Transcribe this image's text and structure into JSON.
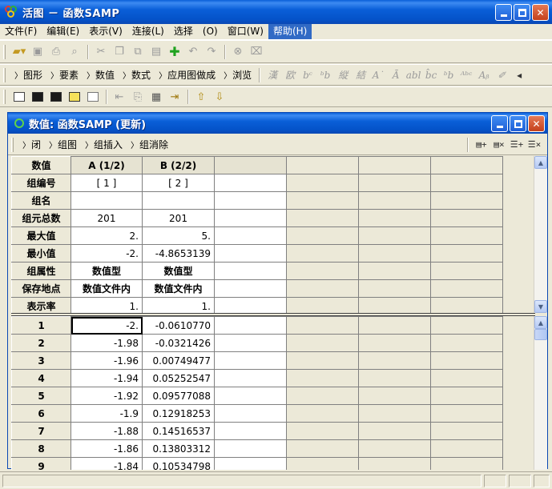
{
  "window": {
    "title": "活图 － 函数SAMP"
  },
  "menu": [
    "文件(F)",
    "编辑(E)",
    "表示(V)",
    "连接(L)",
    "选择",
    "(O)",
    "窗口(W)",
    "帮助(H)"
  ],
  "toolbar2": {
    "commands": [
      "图形",
      "要素",
      "数值",
      "数式",
      "应用图做成",
      "浏览"
    ]
  },
  "child": {
    "title": "数值: 函数SAMP (更新)",
    "toolbar": {
      "commands": [
        "闭",
        "组图",
        "组插入",
        "组消除"
      ]
    },
    "columns": [
      "数值",
      "A (1/2)",
      "B (2/2)",
      "",
      "",
      "",
      ""
    ],
    "properties": [
      {
        "label": "组编号",
        "a": "[ 1 ]",
        "b": "[ 2 ]"
      },
      {
        "label": "组名",
        "a": "",
        "b": ""
      },
      {
        "label": "组元总数",
        "a": "201",
        "b": "201"
      },
      {
        "label": "最大值",
        "a": "2.",
        "b": "5."
      },
      {
        "label": "最小值",
        "a": "-2.",
        "b": "-4.8653139"
      },
      {
        "label": "组属性",
        "a": "数值型",
        "b": "数值型"
      },
      {
        "label": "保存地点",
        "a": "数值文件内",
        "b": "数值文件内"
      },
      {
        "label": "表示率",
        "a": "1.",
        "b": "1."
      }
    ],
    "rows": [
      {
        "n": "1",
        "a": "-2.",
        "b": "-0.0610770"
      },
      {
        "n": "2",
        "a": "-1.98",
        "b": "-0.0321426"
      },
      {
        "n": "3",
        "a": "-1.96",
        "b": "0.00749477"
      },
      {
        "n": "4",
        "a": "-1.94",
        "b": "0.05252547"
      },
      {
        "n": "5",
        "a": "-1.92",
        "b": "0.09577088"
      },
      {
        "n": "6",
        "a": "-1.9",
        "b": "0.12918253"
      },
      {
        "n": "7",
        "a": "-1.88",
        "b": "0.14516537"
      },
      {
        "n": "8",
        "a": "-1.86",
        "b": "0.13803312"
      },
      {
        "n": "9",
        "a": "-1.84",
        "b": "0.10534798"
      }
    ]
  }
}
